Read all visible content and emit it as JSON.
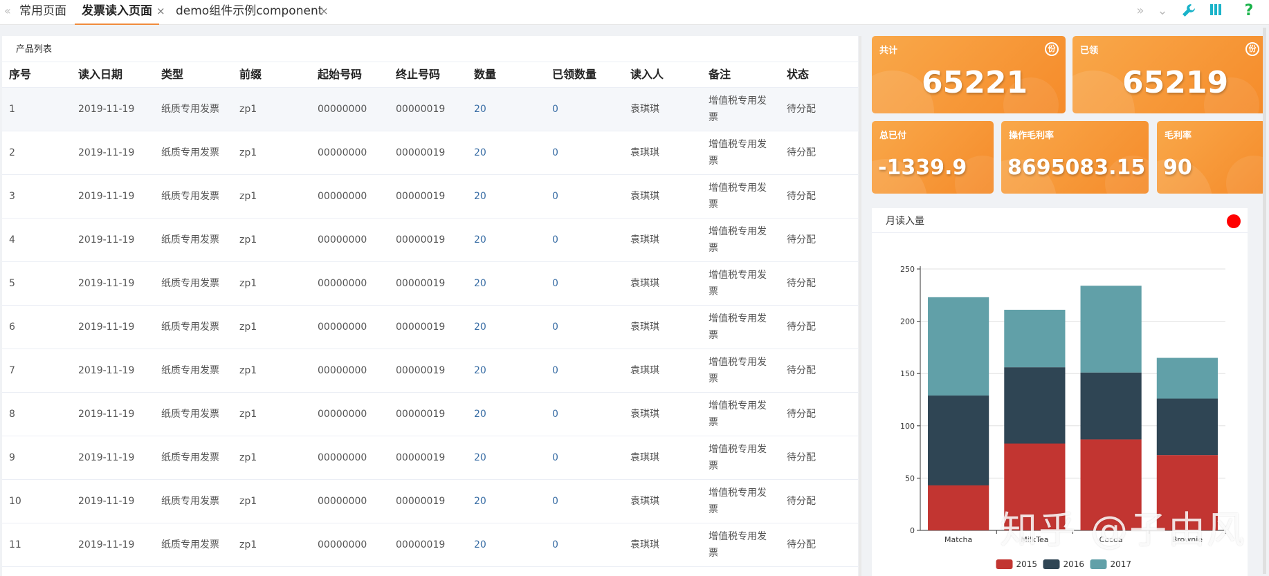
{
  "tabs": [
    {
      "label": "常用页面",
      "active": false,
      "closable": false
    },
    {
      "label": "发票读入页面",
      "active": true,
      "closable": true
    },
    {
      "label": "demo组件示例component",
      "active": false,
      "closable": true
    }
  ],
  "toolbar": {
    "icons": [
      "double-chevron-right-icon",
      "chevron-down-icon",
      "wrench-icon",
      "columns-icon",
      "help-icon"
    ],
    "accent": "#f08a3c",
    "tool_color": "#1ab3c9"
  },
  "table": {
    "title": "产品列表",
    "columns": [
      "序号",
      "读入日期",
      "类型",
      "前缀",
      "起始号码",
      "终止号码",
      "数量",
      "已领数量",
      "读入人",
      "备注",
      "状态"
    ],
    "rows": [
      [
        "1",
        "2019-11-19",
        "纸质专用发票",
        "zp1",
        "00000000",
        "00000019",
        "20",
        "0",
        "袁琪琪",
        "增值税专用发票",
        "待分配"
      ],
      [
        "2",
        "2019-11-19",
        "纸质专用发票",
        "zp1",
        "00000000",
        "00000019",
        "20",
        "0",
        "袁琪琪",
        "增值税专用发票",
        "待分配"
      ],
      [
        "3",
        "2019-11-19",
        "纸质专用发票",
        "zp1",
        "00000000",
        "00000019",
        "20",
        "0",
        "袁琪琪",
        "增值税专用发票",
        "待分配"
      ],
      [
        "4",
        "2019-11-19",
        "纸质专用发票",
        "zp1",
        "00000000",
        "00000019",
        "20",
        "0",
        "袁琪琪",
        "增值税专用发票",
        "待分配"
      ],
      [
        "5",
        "2019-11-19",
        "纸质专用发票",
        "zp1",
        "00000000",
        "00000019",
        "20",
        "0",
        "袁琪琪",
        "增值税专用发票",
        "待分配"
      ],
      [
        "6",
        "2019-11-19",
        "纸质专用发票",
        "zp1",
        "00000000",
        "00000019",
        "20",
        "0",
        "袁琪琪",
        "增值税专用发票",
        "待分配"
      ],
      [
        "7",
        "2019-11-19",
        "纸质专用发票",
        "zp1",
        "00000000",
        "00000019",
        "20",
        "0",
        "袁琪琪",
        "增值税专用发票",
        "待分配"
      ],
      [
        "8",
        "2019-11-19",
        "纸质专用发票",
        "zp1",
        "00000000",
        "00000019",
        "20",
        "0",
        "袁琪琪",
        "增值税专用发票",
        "待分配"
      ],
      [
        "9",
        "2019-11-19",
        "纸质专用发票",
        "zp1",
        "00000000",
        "00000019",
        "20",
        "0",
        "袁琪琪",
        "增值税专用发票",
        "待分配"
      ],
      [
        "10",
        "2019-11-19",
        "纸质专用发票",
        "zp1",
        "00000000",
        "00000019",
        "20",
        "0",
        "袁琪琪",
        "增值税专用发票",
        "待分配"
      ],
      [
        "11",
        "2019-11-19",
        "纸质专用发票",
        "zp1",
        "00000000",
        "00000019",
        "20",
        "0",
        "袁琪琪",
        "增值税专用发票",
        "待分配"
      ]
    ]
  },
  "stats": {
    "total": {
      "label": "共计",
      "value": "65221",
      "badge": "份"
    },
    "claimed": {
      "label": "已领",
      "value": "65219",
      "badge": "份"
    },
    "paid": {
      "label": "总已付",
      "value": "-1339.9"
    },
    "op_margin": {
      "label": "操作毛利率",
      "value": "8695083.15"
    },
    "margin": {
      "label": "毛利率",
      "value": "90"
    }
  },
  "chart_panel": {
    "title": "月读入量",
    "status_color": "#ff0000"
  },
  "chart_data": {
    "type": "bar",
    "stacked": true,
    "categories": [
      "Matcha",
      "MilkTea",
      "Cocoa",
      "Brownie"
    ],
    "series": [
      {
        "name": "2015",
        "values": [
          43,
          83,
          87,
          72
        ],
        "color": "#c23531"
      },
      {
        "name": "2016",
        "values": [
          86,
          73,
          64,
          54
        ],
        "color": "#2f4554"
      },
      {
        "name": "2017",
        "values": [
          94,
          55,
          83,
          39
        ],
        "color": "#61a0a8"
      }
    ],
    "ylim": [
      0,
      250
    ],
    "yticks": [
      0,
      50,
      100,
      150,
      200,
      250
    ],
    "grid": true,
    "legend": "bottom-center"
  },
  "watermark": "知乎 @子由风"
}
